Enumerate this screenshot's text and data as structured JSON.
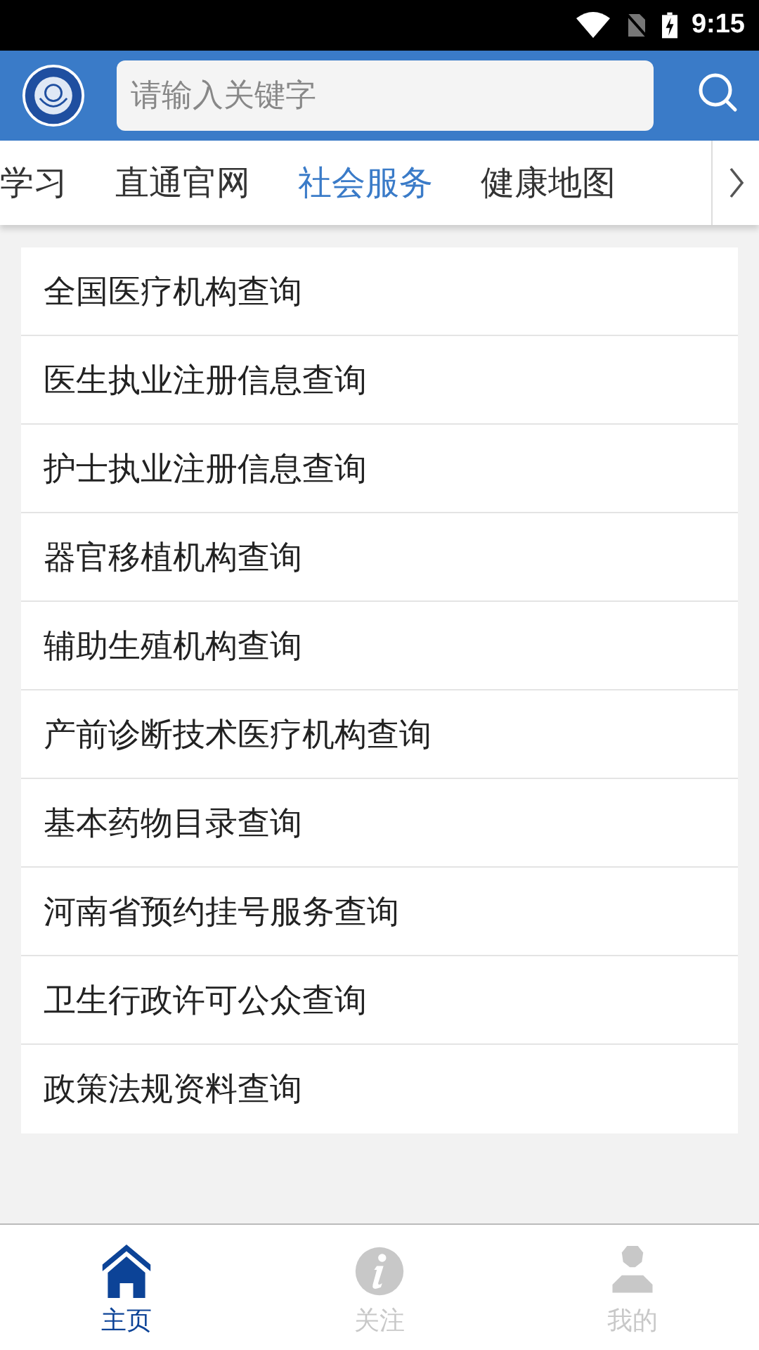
{
  "status_bar": {
    "time": "9:15"
  },
  "search": {
    "placeholder": "请输入关键字"
  },
  "tabs": [
    {
      "label": "学习",
      "selected": false
    },
    {
      "label": "直通官网",
      "selected": false
    },
    {
      "label": "社会服务",
      "selected": true
    },
    {
      "label": "健康地图",
      "selected": false
    }
  ],
  "list": [
    "全国医疗机构查询",
    "医生执业注册信息查询",
    "护士执业注册信息查询",
    "器官移植机构查询",
    "辅助生殖机构查询",
    "产前诊断技术医疗机构查询",
    "基本药物目录查询",
    "河南省预约挂号服务查询",
    "卫生行政许可公众查询",
    "政策法规资料查询"
  ],
  "bottom_nav": [
    {
      "label": "主页",
      "kind": "home",
      "selected": true
    },
    {
      "label": "关注",
      "kind": "info",
      "selected": false
    },
    {
      "label": "我的",
      "kind": "person",
      "selected": false
    }
  ]
}
